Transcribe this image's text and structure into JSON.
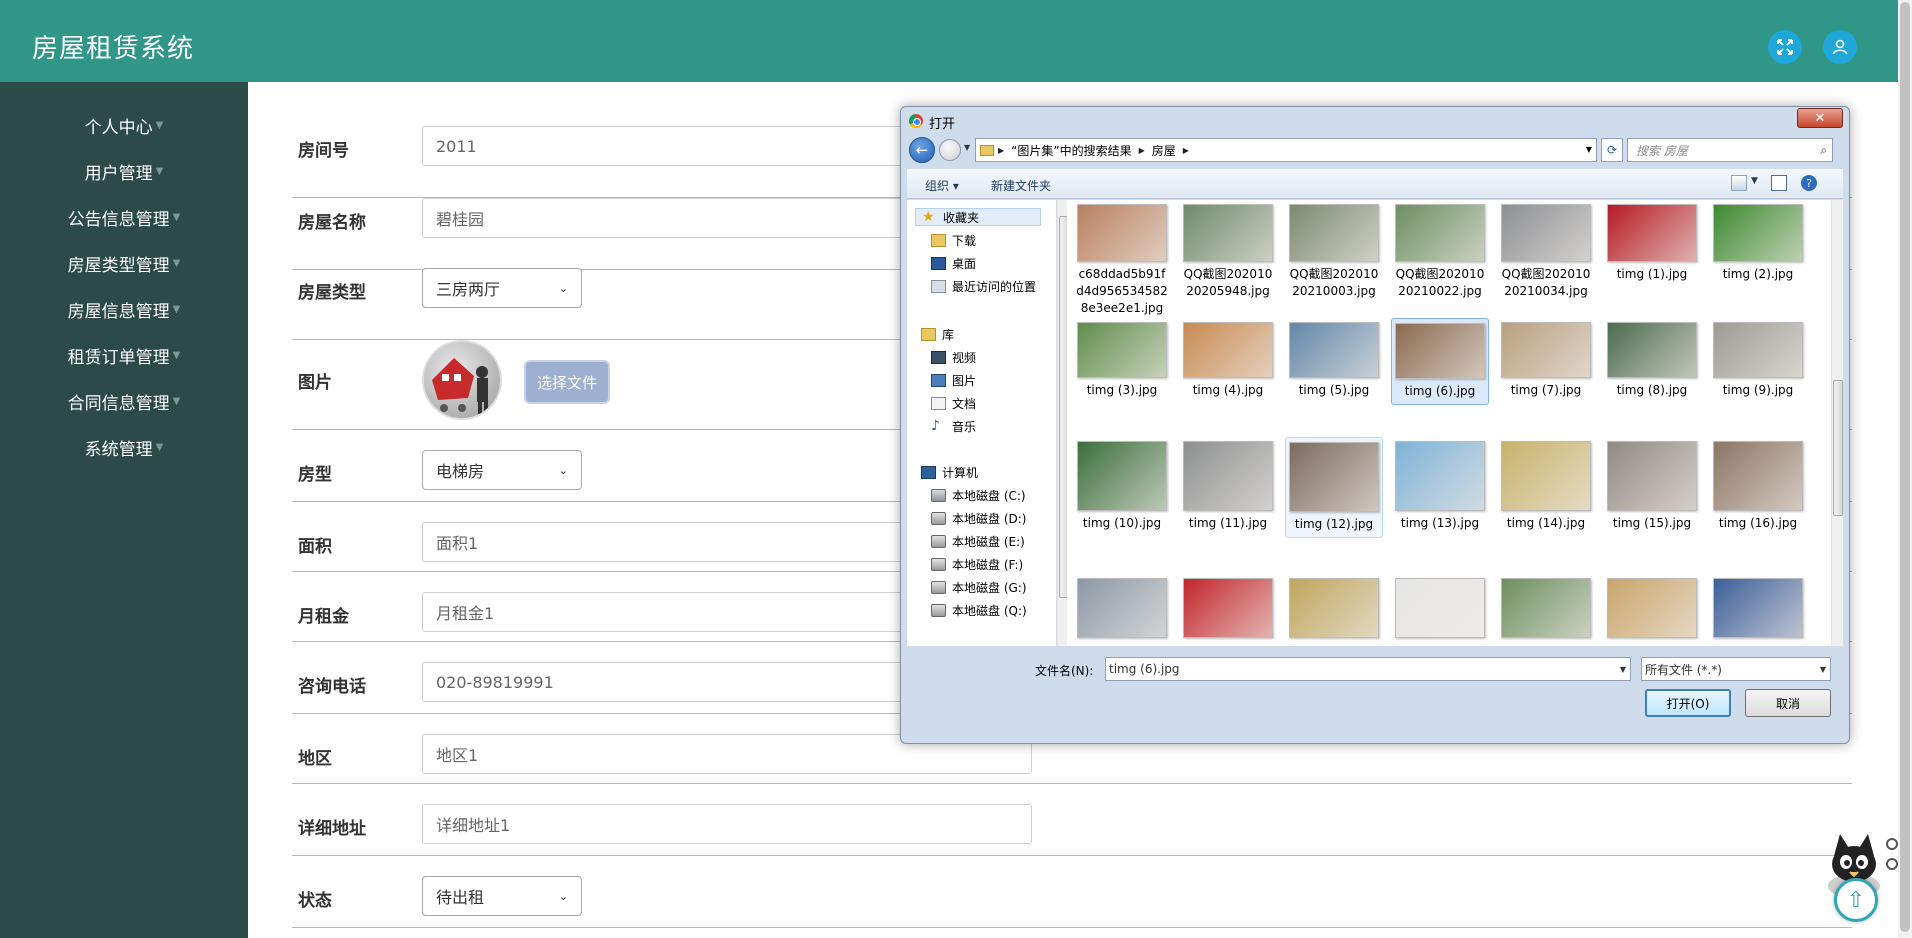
{
  "app": {
    "title": "房屋租赁系统"
  },
  "header": {
    "fullscreen_icon": "fullscreen-icon",
    "user_icon": "user-icon"
  },
  "sidebar": {
    "items": [
      {
        "label": "个人中心"
      },
      {
        "label": "用户管理"
      },
      {
        "label": "公告信息管理"
      },
      {
        "label": "房屋类型管理"
      },
      {
        "label": "房屋信息管理"
      },
      {
        "label": "租赁订单管理"
      },
      {
        "label": "合同信息管理"
      },
      {
        "label": "系统管理"
      }
    ]
  },
  "form": {
    "room_no": {
      "label": "房间号",
      "value": "2011"
    },
    "house_name": {
      "label": "房屋名称",
      "value": "碧桂园"
    },
    "house_type": {
      "label": "房屋类型",
      "value": "三房两厅"
    },
    "picture": {
      "label": "图片",
      "button": "选择文件"
    },
    "layout": {
      "label": "房型",
      "value": "电梯房"
    },
    "area": {
      "label": "面积",
      "value": "面积1"
    },
    "rent": {
      "label": "月租金",
      "value": "月租金1"
    },
    "phone": {
      "label": "咨询电话",
      "value": "020-89819991"
    },
    "region": {
      "label": "地区",
      "value": "地区1"
    },
    "address": {
      "label": "详细地址",
      "value": "详细地址1"
    },
    "status": {
      "label": "状态",
      "value": "待出租"
    }
  },
  "dialog": {
    "title": "打开",
    "close_label": "✕",
    "breadcrumb": [
      "“图片集”中的搜索结果",
      "房屋"
    ],
    "search_placeholder": "搜索 房屋",
    "toolbar": {
      "organize": "组织 ▾",
      "new_folder": "新建文件夹"
    },
    "nav": {
      "favorites": "收藏夹",
      "downloads": "下载",
      "desktop": "桌面",
      "recent": "最近访问的位置",
      "libraries": "库",
      "videos": "视频",
      "pictures": "图片",
      "documents": "文档",
      "music": "音乐",
      "computer": "计算机",
      "drives": [
        "本地磁盘 (C:)",
        "本地磁盘 (D:)",
        "本地磁盘 (E:)",
        "本地磁盘 (F:)",
        "本地磁盘 (G:)",
        "本地磁盘 (Q:)"
      ]
    },
    "files_row1": [
      {
        "name": "c68ddad5b91fd4d9565345828e3ee2e1.jpg",
        "color": "#b9805f"
      },
      {
        "name": "QQ截图20201020205948.jpg",
        "color": "#6f8a6c"
      },
      {
        "name": "QQ截图20201020210003.jpg",
        "color": "#7c8a72"
      },
      {
        "name": "QQ截图20201020210022.jpg",
        "color": "#6c8f62"
      },
      {
        "name": "QQ截图20201020210034.jpg",
        "color": "#8d8f93"
      },
      {
        "name": "timg (1).jpg",
        "color": "#b51b24"
      },
      {
        "name": "timg (2).jpg",
        "color": "#3d8a2f"
      }
    ],
    "files_row2": [
      {
        "name": "timg (3).jpg",
        "color": "#5f8d4c"
      },
      {
        "name": "timg (4).jpg",
        "color": "#c78a52"
      },
      {
        "name": "timg (5).jpg",
        "color": "#6287a9"
      },
      {
        "name": "timg (6).jpg",
        "color": "#8a6a4f"
      },
      {
        "name": "timg (7).jpg",
        "color": "#b8a07f"
      },
      {
        "name": "timg (8).jpg",
        "color": "#4c6b4e"
      },
      {
        "name": "timg (9).jpg",
        "color": "#9b9b93"
      }
    ],
    "files_row3": [
      {
        "name": "timg (10).jpg",
        "color": "#3c6f3d"
      },
      {
        "name": "timg (11).jpg",
        "color": "#8d8f90"
      },
      {
        "name": "timg (12).jpg",
        "color": "#7d6a5f"
      },
      {
        "name": "timg (13).jpg",
        "color": "#7fb3d6"
      },
      {
        "name": "timg (14).jpg",
        "color": "#c8b26b"
      },
      {
        "name": "timg (15).jpg",
        "color": "#8f8a82"
      },
      {
        "name": "timg (16).jpg",
        "color": "#8c7563"
      }
    ],
    "files_row4": [
      {
        "name": "",
        "color": "#8c99a6"
      },
      {
        "name": "",
        "color": "#c2262c"
      },
      {
        "name": "",
        "color": "#bfa65f"
      },
      {
        "name": "",
        "color": "#e6e6e6"
      },
      {
        "name": "",
        "color": "#6c8f5f"
      },
      {
        "name": "",
        "color": "#c9a56a"
      },
      {
        "name": "",
        "color": "#3c5f9a"
      }
    ],
    "filename_label": "文件名(N):",
    "filename_value": "timg (6).jpg",
    "filetype_value": "所有文件 (*.*)",
    "open_button": "打开(O)",
    "cancel_button": "取消"
  },
  "colors": {
    "header": "#2f9688",
    "sidebar": "#2c4a47",
    "divider": "#7ed3c6",
    "file_button": "#9db0cf"
  }
}
